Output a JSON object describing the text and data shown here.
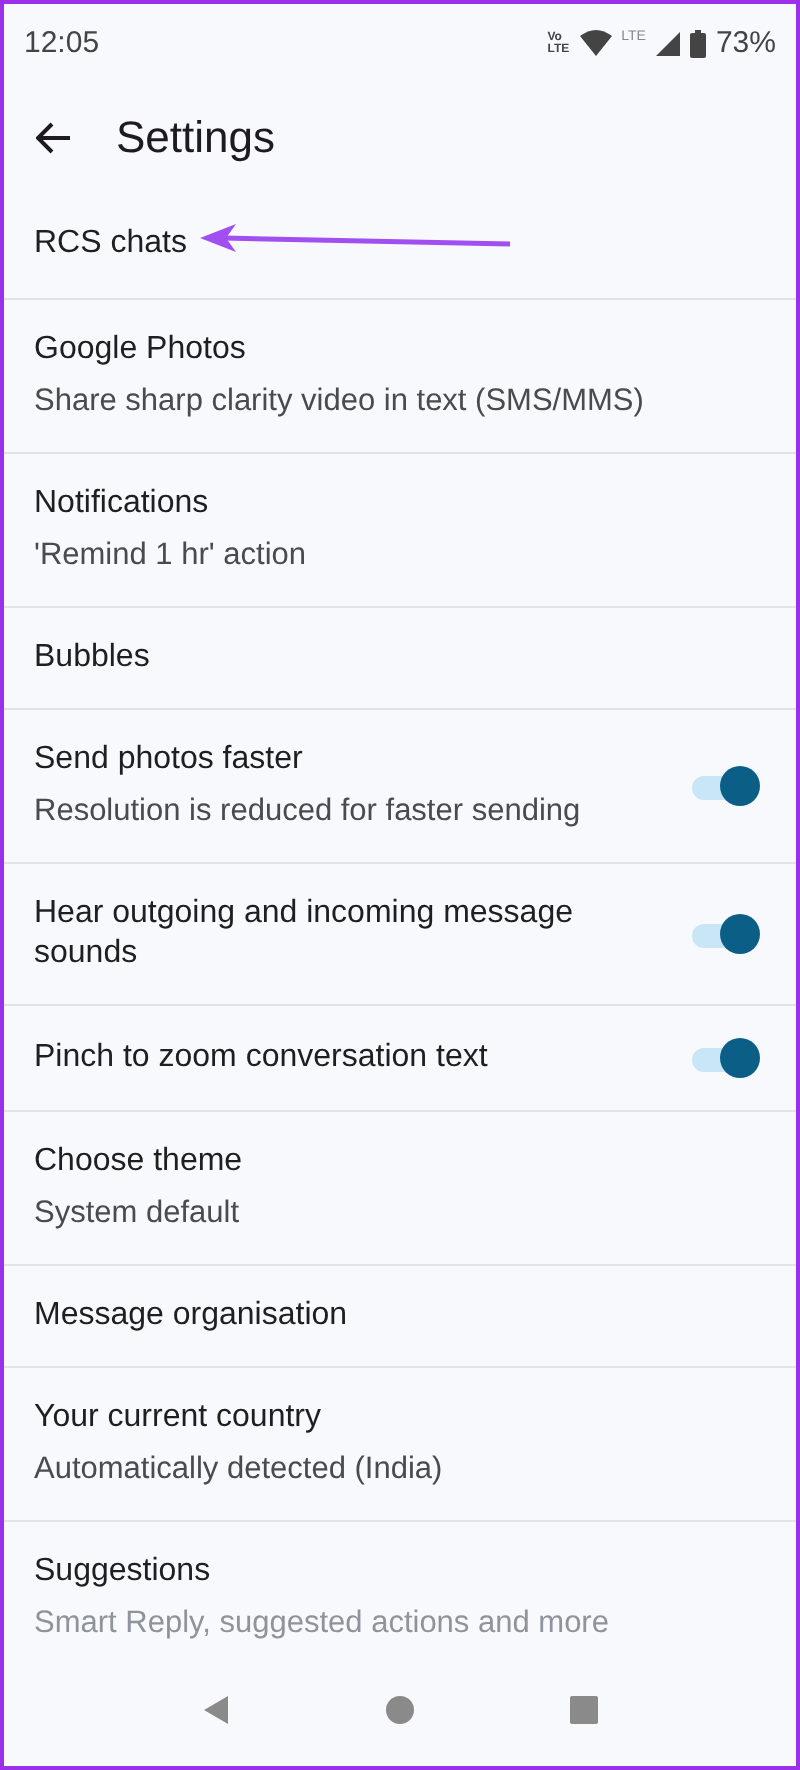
{
  "status_bar": {
    "time": "12:05",
    "volte_lines": [
      "Vo",
      "LTE"
    ],
    "network": "LTE",
    "battery": "73%"
  },
  "header": {
    "title": "Settings"
  },
  "items": [
    {
      "kind": "setting",
      "title": "RCS chats"
    },
    {
      "kind": "setting",
      "title": "Google Photos",
      "subtitle": "Share sharp clarity video in text (SMS/MMS)"
    },
    {
      "kind": "setting",
      "title": "Notifications",
      "subtitle": "'Remind 1 hr' action"
    },
    {
      "kind": "setting",
      "title": "Bubbles"
    },
    {
      "kind": "toggle",
      "title": "Send photos faster",
      "subtitle": "Resolution is reduced for faster sending",
      "on": true
    },
    {
      "kind": "toggle",
      "title": "Hear outgoing and incoming message sounds",
      "on": true
    },
    {
      "kind": "toggle",
      "title": "Pinch to zoom conversation text",
      "on": true
    },
    {
      "kind": "setting",
      "title": "Choose theme",
      "subtitle": "System default"
    },
    {
      "kind": "setting",
      "title": "Message organisation"
    },
    {
      "kind": "setting",
      "title": "Your current country",
      "subtitle": "Automatically detected (India)"
    },
    {
      "kind": "setting",
      "title": "Suggestions",
      "subtitle": "Smart Reply, suggested actions and more"
    }
  ]
}
